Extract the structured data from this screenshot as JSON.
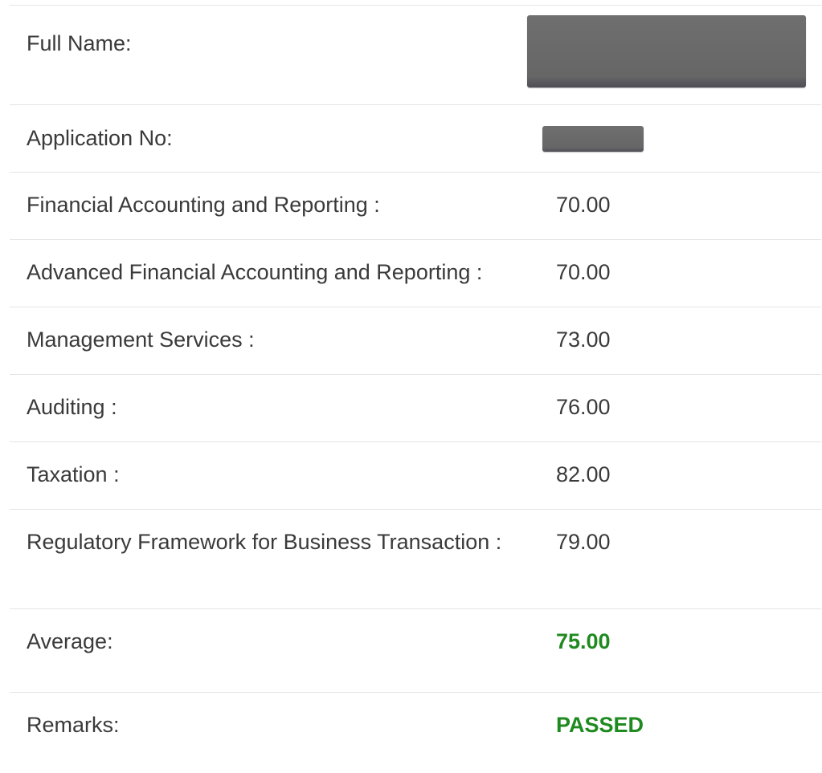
{
  "full_name": {
    "label": "Full Name:"
  },
  "application_no": {
    "label": "Application No:"
  },
  "subjects": [
    {
      "label": "Financial Accounting and Reporting :",
      "score": "70.00"
    },
    {
      "label": "Advanced Financial Accounting and Reporting :",
      "score": "70.00"
    },
    {
      "label": "Management Services :",
      "score": "73.00"
    },
    {
      "label": "Auditing :",
      "score": "76.00"
    },
    {
      "label": "Taxation :",
      "score": "82.00"
    },
    {
      "label": "Regulatory Framework for Business Transaction :",
      "score": "79.00"
    }
  ],
  "average": {
    "label": "Average:",
    "value": "75.00"
  },
  "remarks": {
    "label": "Remarks:",
    "value": "PASSED"
  },
  "colors": {
    "pass_green": "#1f8a1f",
    "text": "#3a3a3a",
    "divider": "#e4e4e4",
    "redaction": "#666666"
  }
}
